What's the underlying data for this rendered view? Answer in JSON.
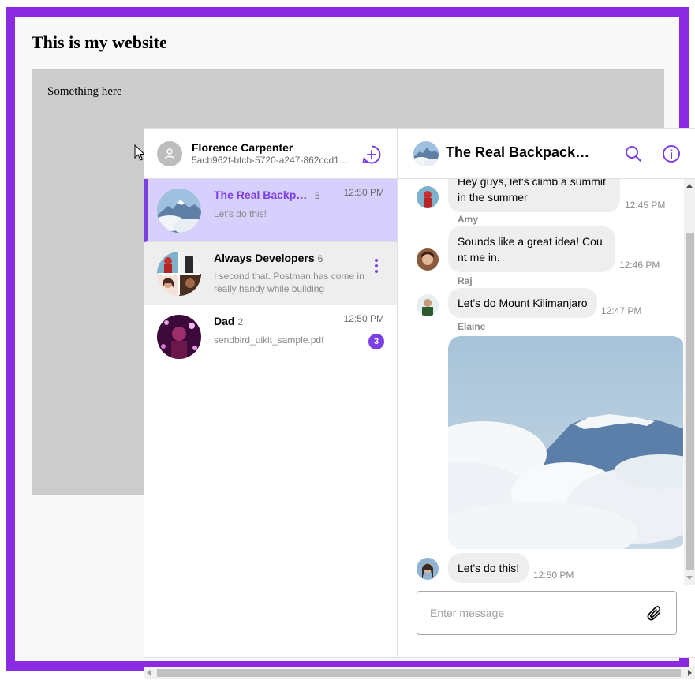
{
  "page": {
    "title": "This is my website",
    "panel_text": "Something here"
  },
  "colors": {
    "frame_border": "#8a2be2",
    "accent": "#7b3fe4",
    "active_channel_bg": "#d7cffc",
    "bubble_bg": "#eeeeee"
  },
  "user": {
    "name": "Florence Carpenter",
    "id": "5acb962f-bfcb-5720-a247-862ccd1…",
    "avatar_icon": "user-icon",
    "new_chat_icon": "plus-circle-icon"
  },
  "channels": [
    {
      "name": "The Real Backpa…",
      "member_count": "5",
      "time": "12:50 PM",
      "last_message": "Let's do this!",
      "state": "active"
    },
    {
      "name": "Always Developers",
      "member_count": "6",
      "last_message": "I second that. Postman has come in really handy while building SendBird's",
      "state": "hover",
      "menu_icon": "more-vertical-icon"
    },
    {
      "name": "Dad",
      "member_count": "2",
      "time": "12:50 PM",
      "last_message": "sendbird_uikit_sample.pdf",
      "unread": "3"
    }
  ],
  "conversation": {
    "title": "The Real Backpack…",
    "search_icon": "search-icon",
    "info_icon": "info-icon",
    "messages": [
      {
        "text": "Hey guys, let's climb a summit in the summer",
        "time": "12:45 PM"
      },
      {
        "sender": "Amy",
        "text": "Sounds like a great idea! Count me in.",
        "time": "12:46 PM"
      },
      {
        "sender": "Raj",
        "text": "Let's do Mount Kilimanjaro",
        "time": "12:47 PM"
      },
      {
        "sender": "Elaine",
        "image": "mountain-photo"
      },
      {
        "text": "Let's do this!",
        "time": "12:50 PM"
      }
    ],
    "composer": {
      "placeholder": "Enter message",
      "attach_icon": "paperclip-icon"
    }
  }
}
